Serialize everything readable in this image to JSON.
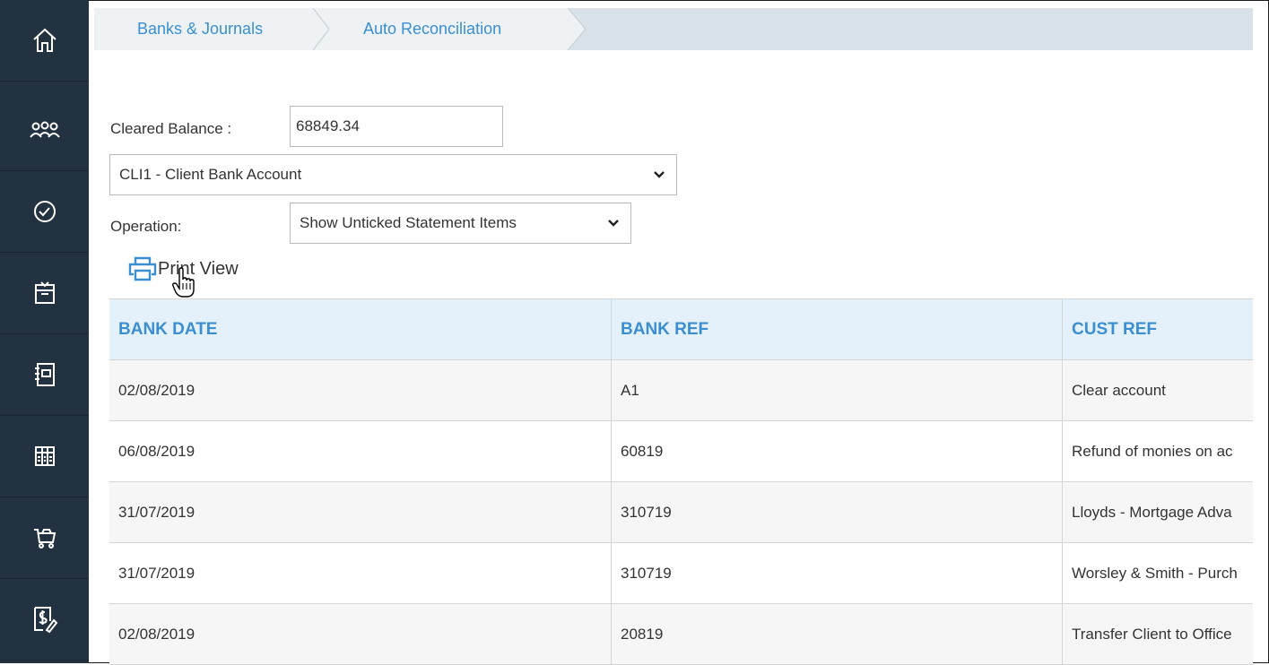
{
  "sidebar": {
    "items": [
      {
        "icon": "home-icon"
      },
      {
        "icon": "people-icon"
      },
      {
        "icon": "clock-icon"
      },
      {
        "icon": "calendar-icon"
      },
      {
        "icon": "notebook-icon"
      },
      {
        "icon": "ledger-icon"
      },
      {
        "icon": "basket-icon"
      },
      {
        "icon": "invoice-dollar-icon"
      }
    ]
  },
  "breadcrumb": {
    "items": [
      "Banks & Journals",
      "Auto Reconciliation"
    ]
  },
  "form": {
    "cleared_balance_label": "Cleared Balance :",
    "cleared_balance_value": "68849.34",
    "account_selected": "CLI1 - Client Bank Account",
    "operation_label": "Operation:",
    "operation_selected": "Show Unticked Statement Items"
  },
  "toolbar": {
    "print_view_label": "Print View"
  },
  "table": {
    "columns": [
      "BANK DATE",
      "BANK REF",
      "CUST REF"
    ],
    "rows": [
      [
        "02/08/2019",
        "A1",
        "Clear account"
      ],
      [
        "06/08/2019",
        "60819",
        "Refund of monies on ac"
      ],
      [
        "31/07/2019",
        "310719",
        "Lloyds - Mortgage Adva"
      ],
      [
        "31/07/2019",
        "310719",
        "Worsley & Smith - Purch"
      ],
      [
        "02/08/2019",
        "20819",
        "Transfer Client to Office"
      ]
    ]
  },
  "colors": {
    "sidebar_bg": "#233240",
    "accent": "#3b8fd0",
    "header_bg": "#e4f0fa"
  }
}
